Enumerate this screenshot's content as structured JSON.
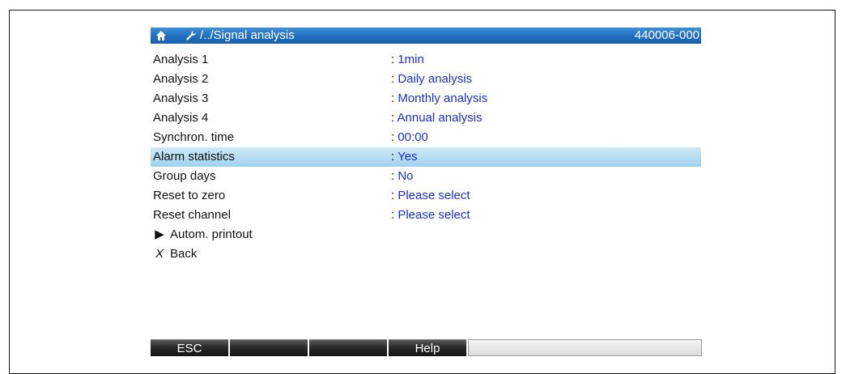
{
  "header": {
    "home_icon": "home-icon",
    "wrench_icon": "wrench-icon",
    "path": "/../Signal analysis",
    "id": "440006-000",
    "bar_color": "#1f6fc0"
  },
  "menu": {
    "separator": ":",
    "items": [
      {
        "label": "Analysis 1",
        "value": "1min"
      },
      {
        "label": "Analysis 2",
        "value": "Daily analysis"
      },
      {
        "label": "Analysis 3",
        "value": "Monthly analysis"
      },
      {
        "label": "Analysis 4",
        "value": "Annual analysis"
      },
      {
        "label": "Synchron. time",
        "value": "00:00"
      },
      {
        "label": "Alarm statistics",
        "value": "Yes",
        "selected": true
      },
      {
        "label": "Group days",
        "value": "No"
      },
      {
        "label": "Reset to zero",
        "value": "Please select"
      },
      {
        "label": "Reset channel",
        "value": "Please select"
      }
    ],
    "submenu": {
      "icon": "▶",
      "label": "Autom. printout"
    },
    "back": {
      "icon": "X",
      "label": "Back"
    },
    "value_color": "#1a2ecc",
    "selection_color": "#9fd2f0"
  },
  "softkeys": {
    "keys": [
      "ESC",
      "",
      "",
      "Help"
    ]
  }
}
